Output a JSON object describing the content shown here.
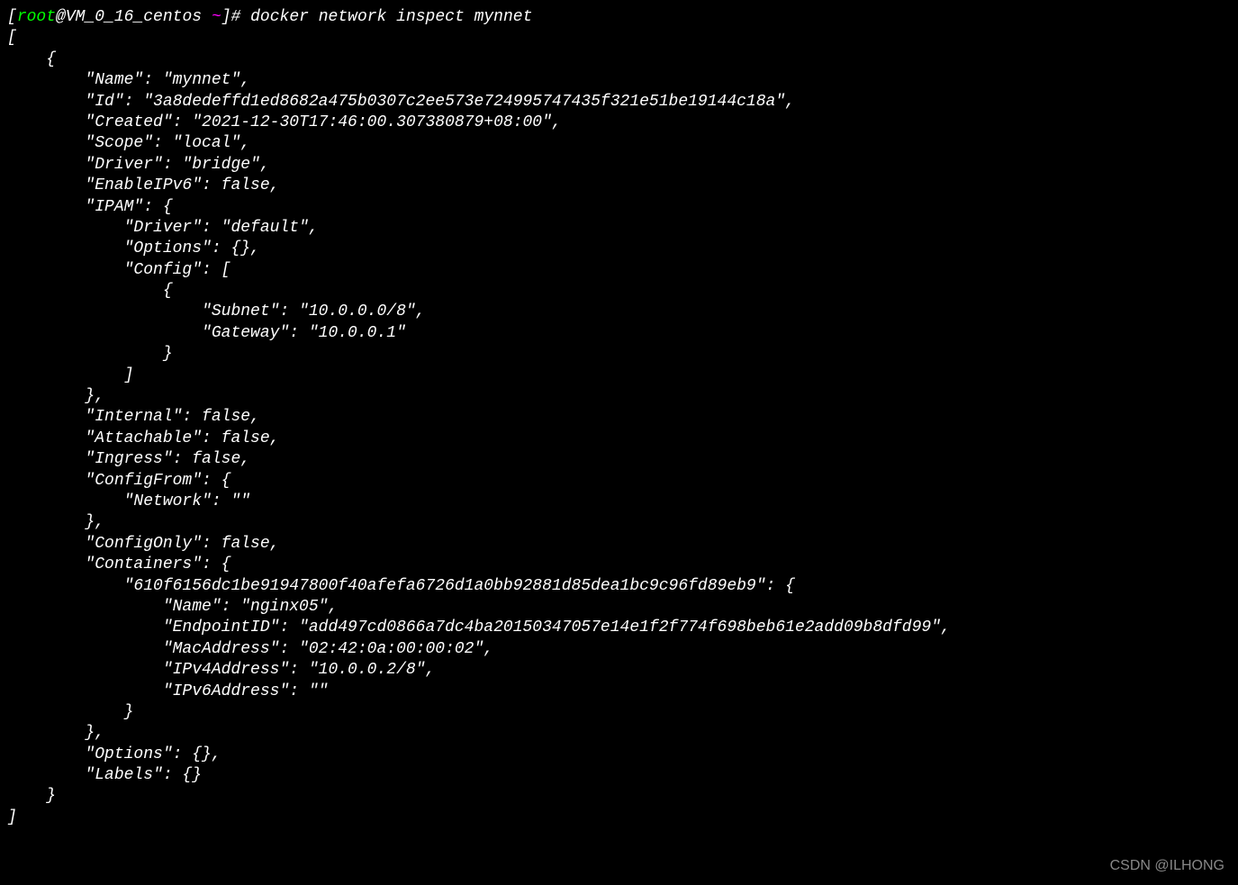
{
  "prompt": {
    "open_bracket": "[",
    "user": "root",
    "at": "@",
    "host": "VM_0_16_centos",
    "space1": " ",
    "tilde": "~",
    "close_bracket": "]",
    "hash": "# ",
    "command": "docker network inspect mynnet"
  },
  "output": {
    "line1": "[",
    "line2": "    {",
    "line3": "        \"Name\": \"mynnet\",",
    "line4": "        \"Id\": \"3a8dedeffd1ed8682a475b0307c2ee573e724995747435f321e51be19144c18a\",",
    "line5": "        \"Created\": \"2021-12-30T17:46:00.307380879+08:00\",",
    "line6": "        \"Scope\": \"local\",",
    "line7": "        \"Driver\": \"bridge\",",
    "line8": "        \"EnableIPv6\": false,",
    "line9": "        \"IPAM\": {",
    "line10": "            \"Driver\": \"default\",",
    "line11": "            \"Options\": {},",
    "line12": "            \"Config\": [",
    "line13": "                {",
    "line14": "                    \"Subnet\": \"10.0.0.0/8\",",
    "line15": "                    \"Gateway\": \"10.0.0.1\"",
    "line16": "                }",
    "line17": "            ]",
    "line18": "        },",
    "line19": "        \"Internal\": false,",
    "line20": "        \"Attachable\": false,",
    "line21": "        \"Ingress\": false,",
    "line22": "        \"ConfigFrom\": {",
    "line23": "            \"Network\": \"\"",
    "line24": "        },",
    "line25": "        \"ConfigOnly\": false,",
    "line26": "        \"Containers\": {",
    "line27": "            \"610f6156dc1be91947800f40afefa6726d1a0bb92881d85dea1bc9c96fd89eb9\": {",
    "line28": "                \"Name\": \"nginx05\",",
    "line29": "                \"EndpointID\": \"add497cd0866a7dc4ba20150347057e14e1f2f774f698beb61e2add09b8dfd99\",",
    "line30": "                \"MacAddress\": \"02:42:0a:00:00:02\",",
    "line31": "                \"IPv4Address\": \"10.0.0.2/8\",",
    "line32": "                \"IPv6Address\": \"\"",
    "line33": "            }",
    "line34": "        },",
    "line35": "        \"Options\": {},",
    "line36": "        \"Labels\": {}",
    "line37": "    }",
    "line38": "]"
  },
  "watermark": "CSDN @ILHONG"
}
